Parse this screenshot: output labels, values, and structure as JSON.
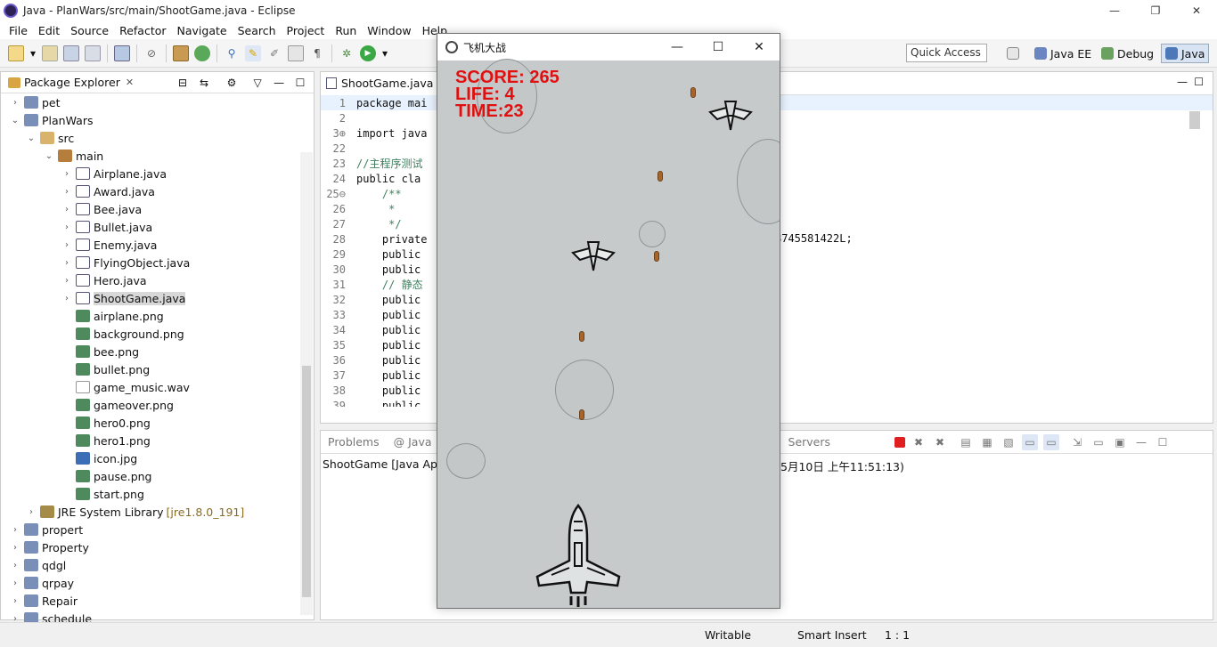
{
  "window": {
    "title": "Java - PlanWars/src/main/ShootGame.java - Eclipse",
    "minimize": "—",
    "restore": "❐",
    "close": "✕"
  },
  "menu": [
    "File",
    "Edit",
    "Source",
    "Refactor",
    "Navigate",
    "Search",
    "Project",
    "Run",
    "Window",
    "Help"
  ],
  "toolbar": {
    "quick_access_placeholder": "Quick Access",
    "perspectives": [
      "Java EE",
      "Debug",
      "Java"
    ]
  },
  "package_explorer": {
    "tab_label": "Package Explorer",
    "tab_close": "✕",
    "items": [
      {
        "label": "pet",
        "icon": "project-icon",
        "chev": "›"
      },
      {
        "label": "PlanWars",
        "icon": "project-icon",
        "chev": "⌄"
      },
      {
        "label": "src",
        "icon": "folder-icon",
        "chev": "⌄"
      },
      {
        "label": "main",
        "icon": "package-icon",
        "chev": "⌄"
      },
      {
        "label": "Airplane.java",
        "icon": "java-file-icon",
        "chev": "›"
      },
      {
        "label": "Award.java",
        "icon": "java-file-icon",
        "chev": "›"
      },
      {
        "label": "Bee.java",
        "icon": "java-file-icon",
        "chev": "›"
      },
      {
        "label": "Bullet.java",
        "icon": "java-file-icon",
        "chev": "›"
      },
      {
        "label": "Enemy.java",
        "icon": "java-file-icon",
        "chev": "›"
      },
      {
        "label": "FlyingObject.java",
        "icon": "java-file-icon",
        "chev": "›"
      },
      {
        "label": "Hero.java",
        "icon": "java-file-icon",
        "chev": "›"
      },
      {
        "label": "ShootGame.java",
        "icon": "java-file-icon",
        "chev": "›"
      },
      {
        "label": "airplane.png",
        "icon": "png-file-icon",
        "chev": ""
      },
      {
        "label": "background.png",
        "icon": "png-file-icon",
        "chev": ""
      },
      {
        "label": "bee.png",
        "icon": "png-file-icon",
        "chev": ""
      },
      {
        "label": "bullet.png",
        "icon": "png-file-icon",
        "chev": ""
      },
      {
        "label": "game_music.wav",
        "icon": "wav-file-icon",
        "chev": ""
      },
      {
        "label": "gameover.png",
        "icon": "png-file-icon",
        "chev": ""
      },
      {
        "label": "hero0.png",
        "icon": "png-file-icon",
        "chev": ""
      },
      {
        "label": "hero1.png",
        "icon": "png-file-icon",
        "chev": ""
      },
      {
        "label": "icon.jpg",
        "icon": "jpg-file-icon",
        "chev": ""
      },
      {
        "label": "pause.png",
        "icon": "png-file-icon",
        "chev": ""
      },
      {
        "label": "start.png",
        "icon": "png-file-icon",
        "chev": ""
      },
      {
        "label": "JRE System Library",
        "sub": "[jre1.8.0_191]",
        "icon": "library-icon",
        "chev": "›"
      },
      {
        "label": "propert",
        "icon": "project-icon",
        "chev": "›"
      },
      {
        "label": "Property",
        "icon": "project-icon",
        "chev": "›"
      },
      {
        "label": "qdgl",
        "icon": "project-icon",
        "chev": "›"
      },
      {
        "label": "qrpay",
        "icon": "project-icon",
        "chev": "›"
      },
      {
        "label": "Repair",
        "icon": "project-icon",
        "chev": "›"
      },
      {
        "label": "schedule",
        "icon": "project-icon",
        "chev": "›"
      }
    ]
  },
  "editor": {
    "tab_label": "ShootGame.java",
    "tab_close": "✕",
    "lines": [
      {
        "n": "1",
        "t": "package mai"
      },
      {
        "n": "2",
        "t": ""
      },
      {
        "n": "3⊕",
        "t": "import java"
      },
      {
        "n": "22",
        "t": ""
      },
      {
        "n": "23",
        "t": "//主程序测试"
      },
      {
        "n": "24",
        "t": "public cla"
      },
      {
        "n": "25⊖",
        "t": "    /**"
      },
      {
        "n": "26",
        "t": "     *"
      },
      {
        "n": "27",
        "t": "     */"
      },
      {
        "n": "28",
        "t": "    private"
      },
      {
        "n": "29",
        "t": "    public"
      },
      {
        "n": "30",
        "t": "    public"
      },
      {
        "n": "31",
        "t": "    // 静态"
      },
      {
        "n": "32",
        "t": "    public"
      },
      {
        "n": "33",
        "t": "    public"
      },
      {
        "n": "34",
        "t": "    public"
      },
      {
        "n": "35",
        "t": "    public"
      },
      {
        "n": "36",
        "t": "    public"
      },
      {
        "n": "37",
        "t": "    public"
      },
      {
        "n": "38",
        "t": "    public"
      },
      {
        "n": "39",
        "t": "    public"
      }
    ],
    "right_text": "8745581422L;"
  },
  "console": {
    "tabs": [
      "Problems",
      "@ Java",
      "Servers"
    ],
    "line_left": "ShootGame [Java App",
    "line_right": "5月10日 上午11:51:13)"
  },
  "statusbar": {
    "writable": "Writable",
    "insert": "Smart Insert",
    "position": "1 : 1"
  },
  "game": {
    "title": "飞机大战",
    "minimize": "—",
    "maximize": "☐",
    "close": "✕",
    "score": "SCORE: 265",
    "life": "LIFE: 4",
    "time": "TIME:23"
  }
}
